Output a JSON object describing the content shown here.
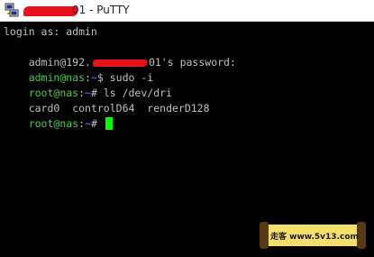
{
  "window": {
    "title_suffix": "01 - PuTTY"
  },
  "terminal": {
    "lines": [
      {
        "text": "login as: admin"
      },
      {
        "prefix": "admin@192.",
        "suffix": "01's password:"
      },
      {
        "user": "admin@nas",
        "sep": ":",
        "path": "~",
        "rest": "$ sudo -i"
      },
      {
        "user": "root@nas",
        "sep": ":",
        "path": "~",
        "rest": "# ls /dev/dri"
      },
      {
        "entries": [
          "card0",
          "controlD64",
          "renderD128"
        ]
      },
      {
        "user": "root@nas",
        "sep": ":",
        "path": "~",
        "rest": "# "
      }
    ]
  },
  "watermark": {
    "text": "走客 www.5v13.com"
  },
  "colors": {
    "prompt_user": "#4ccd4c",
    "prompt_path": "#6b76ff",
    "output": "#c0c0c0",
    "cursor": "#00ff00",
    "redaction": "#e8121a"
  },
  "icons": {
    "app": "putty-icon"
  }
}
